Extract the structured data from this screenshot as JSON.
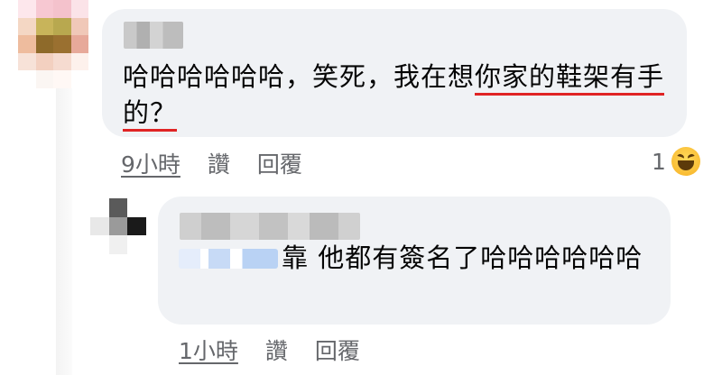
{
  "comments": [
    {
      "text_before": "哈哈哈哈哈哈，笑死，我在想",
      "text_underlined": "你家的鞋架有手的？",
      "time": "9小時",
      "like": "讚",
      "reply": "回覆",
      "reaction_count": "1",
      "reaction_icon": "laughing-emoji-icon"
    },
    {
      "text": "靠 他都有簽名了哈哈哈哈哈哈",
      "time": "1小時",
      "like": "讚",
      "reply": "回覆"
    }
  ],
  "colors": {
    "bubble": "#f0f2f5",
    "meta_text": "#65676b",
    "underline": "#e02424"
  }
}
